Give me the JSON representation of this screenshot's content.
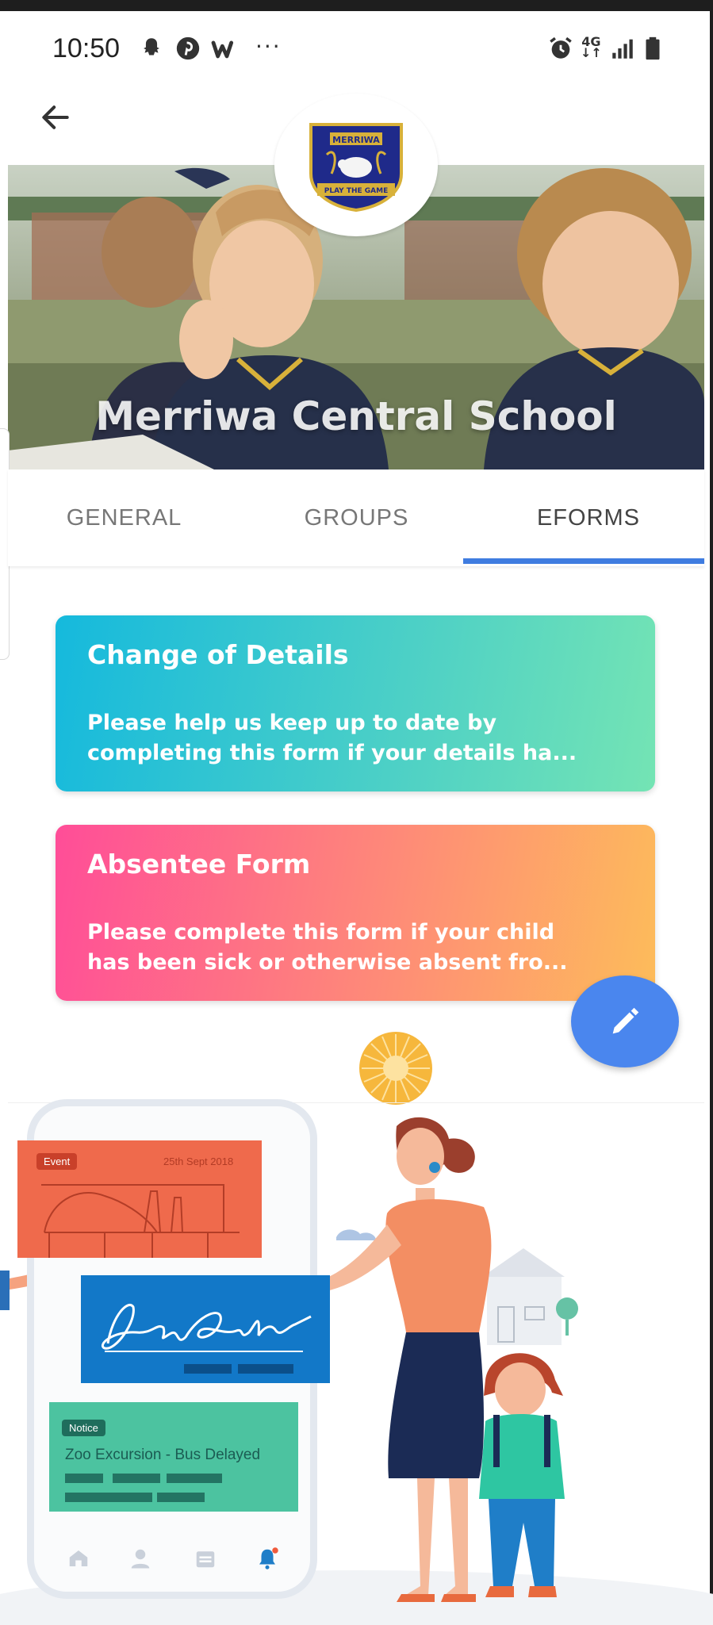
{
  "status_bar": {
    "time": "10:50",
    "more": "···",
    "network": "4G",
    "icons": [
      "snapchat-icon",
      "pinterest-icon",
      "wattpad-icon",
      "alarm-icon",
      "signal-icon",
      "battery-icon"
    ]
  },
  "header": {
    "school_name": "Merriwa Central School",
    "logo_text_top": "MERRIWA",
    "logo_text_bottom": "PLAY THE GAME"
  },
  "tabs": [
    {
      "label": "GENERAL",
      "active": false
    },
    {
      "label": "GROUPS",
      "active": false
    },
    {
      "label": "EFORMS",
      "active": true
    }
  ],
  "forms": [
    {
      "title": "Change of Details",
      "description_line1": "Please help us keep up to date by",
      "description_line2": "completing this form if your details ha..."
    },
    {
      "title": "Absentee Form",
      "description_line1": "Please complete this form if your child",
      "description_line2": "has been sick or otherwise absent fro..."
    }
  ],
  "illustration": {
    "event_badge": "Event",
    "event_date": "25th Sept 2018",
    "notice_badge": "Notice",
    "notice_text": "Zoo Excursion - Bus Delayed"
  },
  "colors": {
    "accent": "#3f7ce0",
    "fab": "#4a86ee",
    "card1_start": "#15b9dd",
    "card1_end": "#74e4b4",
    "card2_start": "#ff4d98",
    "card2_end": "#fdbc5a"
  }
}
